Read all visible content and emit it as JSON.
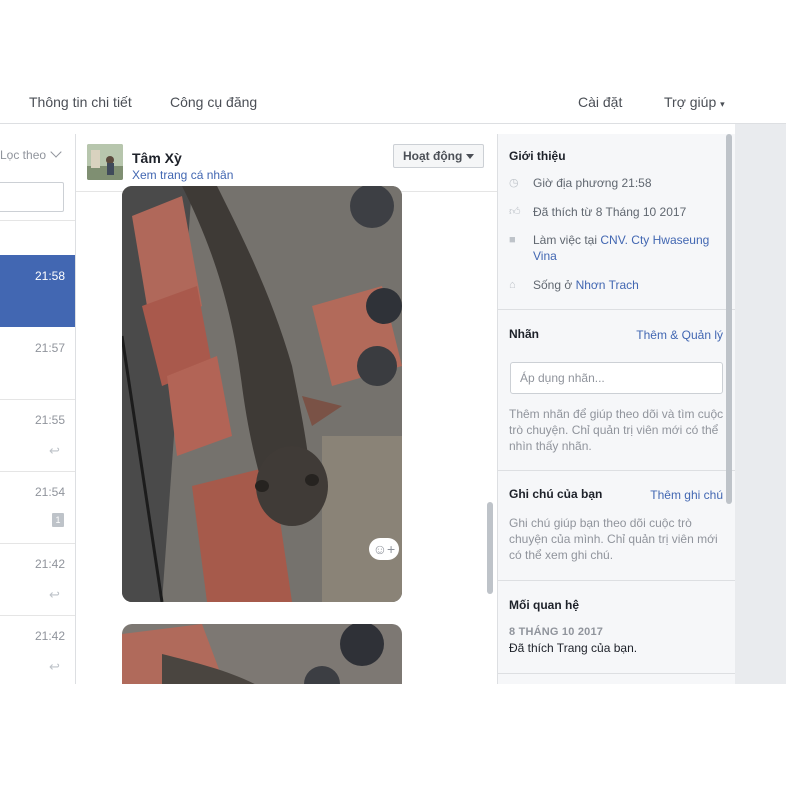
{
  "top_nav": {
    "details": "Thông tin chi tiết",
    "publishing_tools": "Công cụ đăng",
    "settings": "Cài đặt",
    "help": "Trợ giúp"
  },
  "thread_list": {
    "filter_label": "Lọc theo",
    "threads": [
      {
        "time": "21:58"
      },
      {
        "time": "21:57"
      },
      {
        "time": "21:55"
      },
      {
        "time": "21:54",
        "badge": "1"
      },
      {
        "time": "21:42"
      },
      {
        "time": "21:42"
      }
    ]
  },
  "conversation": {
    "name": "Tâm Xỳ",
    "profile_link": "Xem trang cá nhân",
    "status_button": "Hoạt động"
  },
  "info_panel": {
    "intro": {
      "title": "Giới thiệu",
      "local_time": "Giờ địa phương 21:58",
      "liked_since": "Đã thích từ 8 Tháng 10 2017",
      "work_prefix": "Làm việc tại",
      "work_place": "CNV. Cty Hwaseung Vina",
      "lives_prefix": "Sống ở",
      "lives_place": "Nhơn Trach"
    },
    "labels": {
      "title": "Nhãn",
      "action": "Thêm & Quản lý",
      "placeholder": "Áp dụng nhãn...",
      "hint": "Thêm nhãn để giúp theo dõi và tìm cuộc trò chuyện. Chỉ quản trị viên mới có thể nhìn thấy nhãn."
    },
    "notes": {
      "title": "Ghi chú của bạn",
      "action": "Thêm ghi chú",
      "hint": "Ghi chú giúp bạn theo dõi cuộc trò chuyện của mình. Chỉ quản trị viên mới có thể xem ghi chú."
    },
    "relationship": {
      "title": "Mối quan hệ",
      "date": "8 THÁNG 10 2017",
      "event": "Đã thích Trang của bạn."
    }
  },
  "colors": {
    "accent": "#4267b2",
    "panel_bg": "#f6f7f9",
    "border": "#dddfe2"
  }
}
